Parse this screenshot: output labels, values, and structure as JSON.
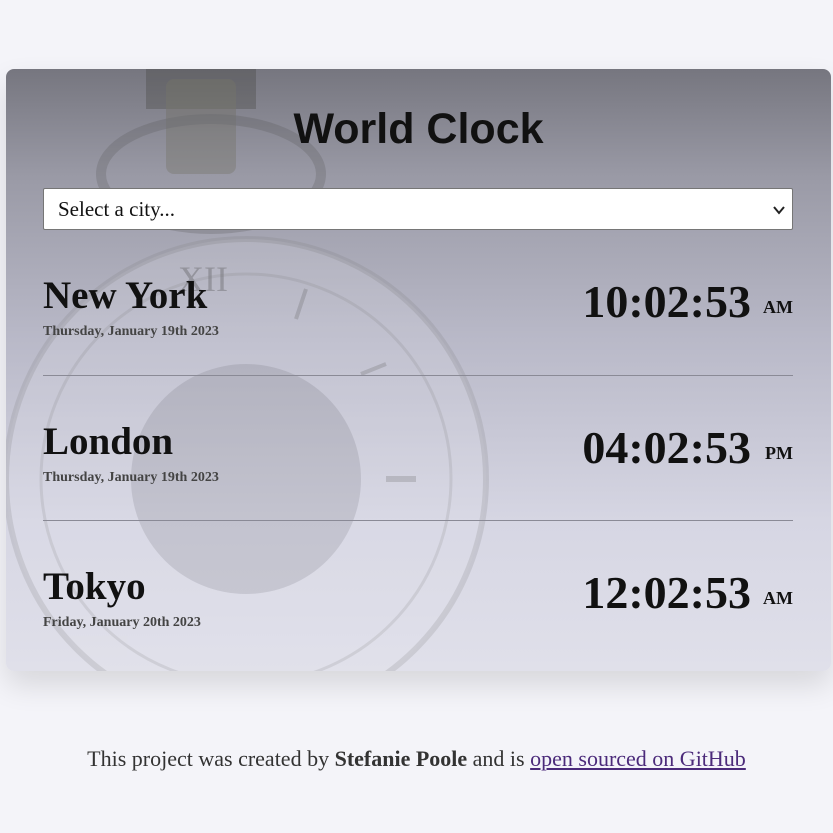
{
  "app": {
    "title": "World Clock"
  },
  "search": {
    "placeholder": "Select a city..."
  },
  "cities": [
    {
      "name": "New York",
      "date": "Thursday, January 19th 2023",
      "time": "10:02:53",
      "ampm": "AM"
    },
    {
      "name": "London",
      "date": "Thursday, January 19th 2023",
      "time": "04:02:53",
      "ampm": "PM"
    },
    {
      "name": "Tokyo",
      "date": "Friday, January 20th 2023",
      "time": "12:02:53",
      "ampm": "AM"
    }
  ],
  "footer": {
    "prefix": "This project was created by",
    "author": "Stefanie Poole",
    "middle": "and is",
    "link_text": "open sourced on GitHub"
  },
  "colors": {
    "page_bg": "#f4f4f9",
    "link": "#4b2a7a"
  }
}
